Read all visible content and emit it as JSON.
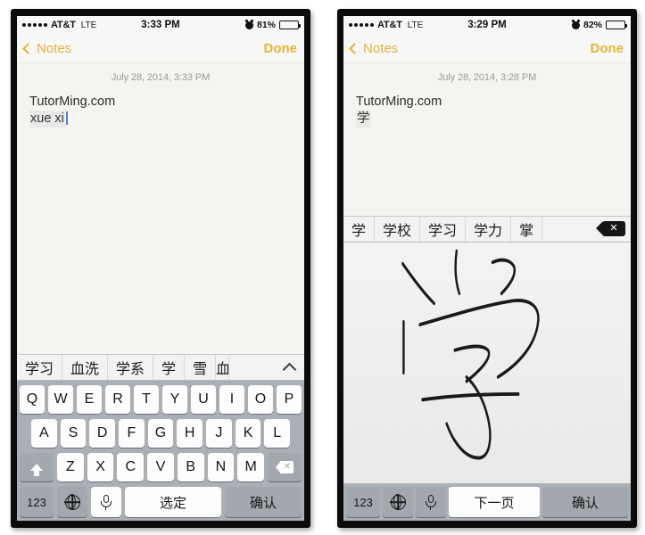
{
  "left_phone": {
    "status_bar": {
      "signal_dots": 5,
      "carrier": "AT&T",
      "network": "LTE",
      "time": "3:33 PM",
      "alarm_icon": "alarm-clock-icon",
      "battery_percent": "81%",
      "battery_level": 81
    },
    "nav_bar": {
      "back_label": "Notes",
      "back_icon": "chevron-left-icon",
      "done_label": "Done"
    },
    "note": {
      "date": "July 28, 2014, 3:33 PM",
      "line1": "TutorMing.com",
      "composing_text": "xue xi"
    },
    "candidates": [
      "学习",
      "血洗",
      "学系",
      "学",
      "雪",
      "血"
    ],
    "expand_icon": "chevron-up-icon",
    "keyboard": {
      "row1": [
        "Q",
        "W",
        "E",
        "R",
        "T",
        "Y",
        "U",
        "I",
        "O",
        "P"
      ],
      "row2": [
        "A",
        "S",
        "D",
        "F",
        "G",
        "H",
        "J",
        "K",
        "L"
      ],
      "row3": [
        "Z",
        "X",
        "C",
        "V",
        "B",
        "N",
        "M"
      ],
      "shift_icon": "shift-arrow-up-icon",
      "backspace_icon": "backspace-delete-icon",
      "number_label": "123",
      "globe_icon": "globe-language-icon",
      "mic_icon": "microphone-icon",
      "space_label": "选定",
      "enter_label": "确认"
    }
  },
  "right_phone": {
    "status_bar": {
      "signal_dots": 5,
      "carrier": "AT&T",
      "network": "LTE",
      "time": "3:29 PM",
      "alarm_icon": "alarm-clock-icon",
      "battery_percent": "82%",
      "battery_level": 82
    },
    "nav_bar": {
      "back_label": "Notes",
      "back_icon": "chevron-left-icon",
      "done_label": "Done"
    },
    "note": {
      "date": "July 28, 2014, 3:28 PM",
      "line1": "TutorMing.com",
      "composing_text": "学"
    },
    "candidates": [
      "学",
      "学校",
      "学习",
      "学力",
      "掌"
    ],
    "delete_icon": "delete-backspace-icon",
    "handwriting": {
      "pad_name": "handwriting-input-pad",
      "drawn_character": "学"
    },
    "bottom_bar": {
      "number_label": "123",
      "globe_icon": "globe-language-icon",
      "mic_icon": "microphone-icon",
      "next_page_label": "下一页",
      "enter_label": "确认"
    }
  },
  "colors": {
    "accent_yellow": "#e2b33c",
    "keyboard_bg": "#abafb6",
    "key_white": "#fdfdfd",
    "key_gray": "#a3a7ae",
    "caret_blue": "#4a7fdd"
  }
}
